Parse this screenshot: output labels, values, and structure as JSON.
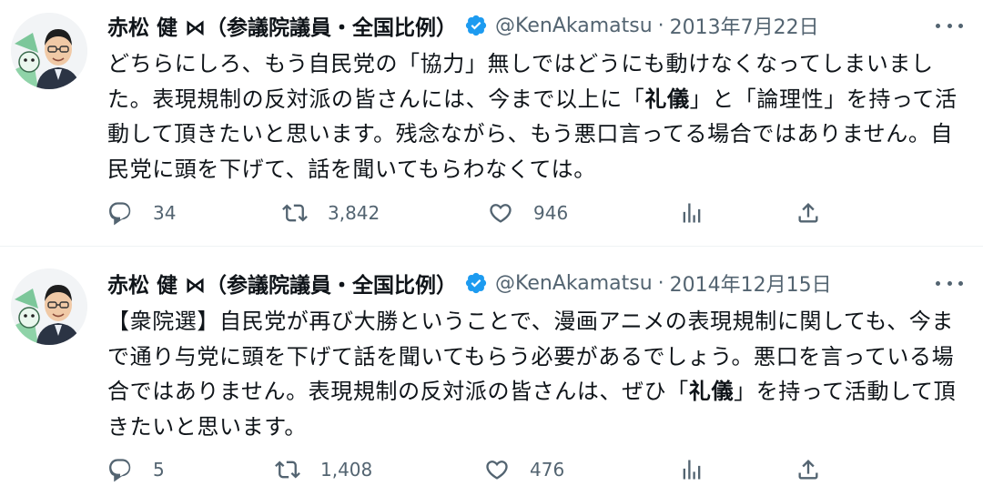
{
  "author": {
    "display_name": "赤松 健 ⋈（参議院議員・全国比例）",
    "handle": "@KenAkamatsu",
    "verified": true,
    "verified_color": "#1d9bf0"
  },
  "separator": "·",
  "tweets": [
    {
      "date": "2013年7月22日",
      "text_parts": [
        "どちらにしろ、もう自民党の「協力」無しではどうにも動けなくなってしまいました。表現規制の反対派の皆さんには、今まで以上に「",
        "礼儀",
        "」と「論理性」を持って活動して頂きたいと思います。残念ながら、もう悪口言ってる場合ではありません。自民党に頭を下げて、話を聞いてもらわなくては。"
      ],
      "replies": "34",
      "retweets": "3,842",
      "likes": "946"
    },
    {
      "date": "2014年12月15日",
      "text_parts": [
        "【衆院選】自民党が再び大勝ということで、漫画アニメの表現規制に関しても、今まで通り与党に頭を下げて話を聞いてもらう必要があるでしょう。悪口を言っている場合ではありません。表現規制の反対派の皆さんは、ぜひ「",
        "礼儀",
        "」を持って活動して頂きたいと思います。"
      ],
      "replies": "5",
      "retweets": "1,408",
      "likes": "476"
    }
  ],
  "icons": {
    "reply": "reply-icon",
    "retweet": "retweet-icon",
    "like": "like-icon",
    "views": "analytics-icon",
    "share": "share-icon",
    "more": "more-options-icon",
    "verified": "verified-badge-icon"
  },
  "colors": {
    "text": "#0f1419",
    "secondary": "#536471",
    "divider": "#eff3f4",
    "verified": "#1d9bf0"
  }
}
